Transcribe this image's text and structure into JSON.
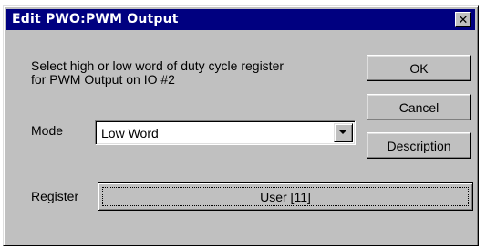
{
  "dialog": {
    "title": "Edit PWO:PWM Output",
    "close_glyph": "✕",
    "description_line1": "Select high or low word of duty cycle register",
    "description_line2": "for PWM Output on IO #2",
    "mode_label": "Mode",
    "mode_value": "Low Word",
    "register_label": "Register",
    "register_value": "User [11]"
  },
  "buttons": {
    "ok": "OK",
    "cancel": "Cancel",
    "description": "Description"
  },
  "icons": {
    "close": "close-icon",
    "dropdown": "chevron-down-icon"
  }
}
